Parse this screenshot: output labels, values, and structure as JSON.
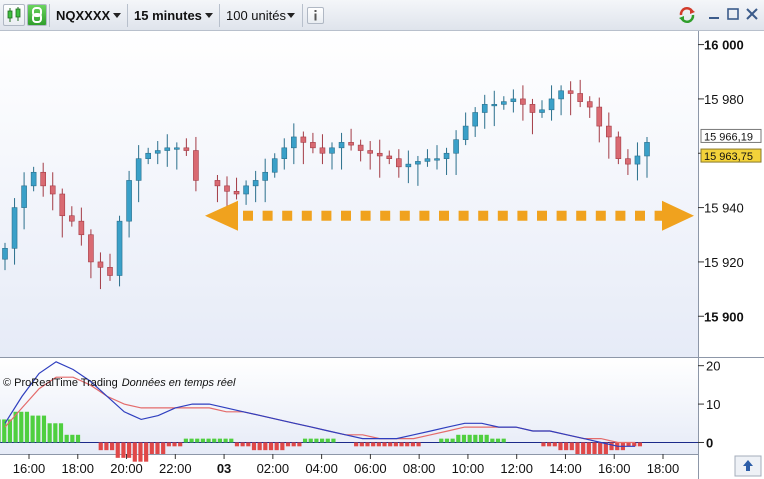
{
  "toolbar": {
    "symbol": "NQXXXX",
    "timeframe": "15 minutes",
    "units": "100 unités",
    "info_icon": "info-icon",
    "icons": [
      "candle-chart-icon",
      "link-icon",
      "refresh-icon",
      "minimize-icon",
      "maximize-icon",
      "close-icon"
    ]
  },
  "price_axis": {
    "ticks": [
      {
        "value": 16000,
        "label": "16 000",
        "bold": true
      },
      {
        "value": 15980,
        "label": "15 980",
        "bold": false
      },
      {
        "value": 15960,
        "label": "",
        "bold": false
      },
      {
        "value": 15940,
        "label": "15 940",
        "bold": false
      },
      {
        "value": 15920,
        "label": "15 920",
        "bold": false
      },
      {
        "value": 15900,
        "label": "15 900",
        "bold": true
      }
    ],
    "high_marker": "15 966,19",
    "last_marker": "15 963,75",
    "last_color": "#f3d23a"
  },
  "osc_axis": {
    "ticks": [
      {
        "value": 20,
        "label": "20",
        "bold": false
      },
      {
        "value": 10,
        "label": "10",
        "bold": false
      },
      {
        "value": 0,
        "label": "0",
        "bold": true
      }
    ]
  },
  "time_axis": {
    "ticks": [
      {
        "label": "16:00",
        "bold": false
      },
      {
        "label": "18:00",
        "bold": false
      },
      {
        "label": "20:00",
        "bold": false
      },
      {
        "label": "22:00",
        "bold": false
      },
      {
        "label": "03",
        "bold": true
      },
      {
        "label": "02:00",
        "bold": false
      },
      {
        "label": "04:00",
        "bold": false
      },
      {
        "label": "06:00",
        "bold": false
      },
      {
        "label": "08:00",
        "bold": false
      },
      {
        "label": "10:00",
        "bold": false
      },
      {
        "label": "12:00",
        "bold": false
      },
      {
        "label": "14:00",
        "bold": false
      },
      {
        "label": "16:00",
        "bold": false
      },
      {
        "label": "18:00",
        "bold": false
      }
    ]
  },
  "copyright": {
    "brand": "© ProRealTime Trading",
    "note": "Données en temps réel"
  },
  "colors": {
    "up": "#3aa0c8",
    "down": "#d96a72",
    "arrow": "#f0a21e",
    "macd_line": "#2f3fbf",
    "signal_line": "#e46b6b",
    "hist_up": "#4fcf3f",
    "hist_down": "#e04848"
  },
  "chart_data": [
    {
      "type": "candlestick",
      "title": "",
      "ylim": [
        15885,
        16005
      ],
      "close": [
        15925,
        15940,
        15948,
        15953,
        15948,
        15945,
        15937,
        15935,
        15930,
        15920,
        15918,
        15915,
        15935,
        15950,
        15958,
        15960,
        15961,
        15962,
        15962,
        15961,
        15950,
        15948,
        15946,
        15945,
        15948,
        15950,
        15953,
        15958,
        15962,
        15966,
        15964,
        15962,
        15960,
        15962,
        15964,
        15963,
        15961,
        15960,
        15959,
        15958,
        15955,
        15956,
        15957,
        15958,
        15958,
        15960,
        15965,
        15970,
        15975,
        15978,
        15978,
        15979,
        15980,
        15978,
        15975,
        15976,
        15980,
        15983,
        15982,
        15979,
        15977,
        15970,
        15966,
        15958,
        15956,
        15959,
        15964
      ],
      "arrow_level": 15937
    },
    {
      "type": "line+bar",
      "title": "",
      "ylim": [
        -3,
        22
      ],
      "macd": [
        5,
        12,
        18,
        21,
        19,
        16,
        12,
        8,
        6,
        7,
        9,
        10,
        10,
        9,
        8,
        7,
        6,
        5,
        4,
        3,
        2,
        1,
        1,
        1,
        2,
        3,
        4,
        5,
        5,
        4,
        4,
        3,
        3,
        2,
        1,
        0,
        -1,
        -1
      ],
      "signal": [
        4,
        9,
        14,
        17,
        17,
        15,
        12,
        10,
        9,
        9,
        9,
        9,
        9,
        8,
        8,
        7,
        6,
        5,
        4,
        3,
        2,
        2,
        1,
        1,
        1,
        2,
        3,
        4,
        4,
        4,
        4,
        3,
        3,
        2,
        1,
        1,
        0,
        0
      ],
      "histogram": [
        6,
        8,
        7,
        5,
        2,
        0,
        -2,
        -4,
        -5,
        -3,
        -1,
        1,
        1,
        1,
        -1,
        -2,
        -2,
        -1,
        1,
        1,
        0,
        -1,
        -1,
        -1,
        -1,
        0,
        1,
        2,
        2,
        1,
        0,
        0,
        -1,
        -2,
        -3,
        -3,
        -2,
        -1
      ]
    }
  ]
}
